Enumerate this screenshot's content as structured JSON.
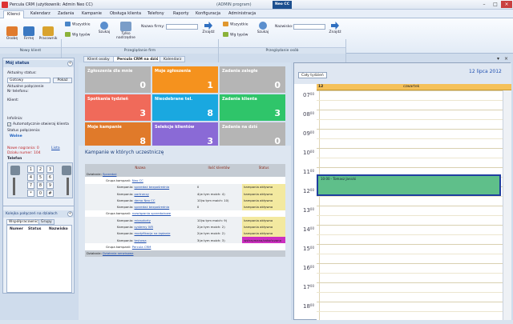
{
  "window": {
    "title": "Percula CRM (użytkownik: Admin Neo CC)",
    "center_title": "(ADMIN program)",
    "brand": "Neo CC"
  },
  "menu": {
    "tabs": [
      "Klienci",
      "Kalendarz",
      "Zadania",
      "Kampanie",
      "Obsługa klienta",
      "Telefony",
      "Raporty",
      "Konfiguracja",
      "Administracja"
    ],
    "active": "Klienci"
  },
  "ribbon": {
    "nowy_klient": {
      "label": "Nowy klient",
      "buttons": [
        "Osobę",
        "Firmę",
        "Pracownik"
      ]
    },
    "przegladanie_firm": {
      "label": "Przeglądanie firm",
      "wszystkie": "Wszystkie",
      "wg_typow": "Wg typów",
      "szukaj": "Szukaj",
      "tylko_nadrzedne": "Tylko nadrzędne",
      "nazwa_firmy": "Nazwa firmy:",
      "znajdz": "Znajdź"
    },
    "przegladanie_osob": {
      "label": "Przeglądanie osób",
      "wszystkie": "Wszystkie",
      "wg_typow": "Wg typów",
      "szukaj": "Szukaj",
      "nazwisko": "Nazwisko:",
      "znajdz": "Znajdź"
    }
  },
  "subtabs": [
    "Klient osoby",
    "Percula CRM na dziś",
    "Kalendarz"
  ],
  "left": {
    "title": "Mój status",
    "aktualny_status": "Aktualny status:",
    "status_value": "Gotowy",
    "pokaz": "Pokaż",
    "aktualne_polaczenie": "Aktualne połączenie",
    "nr_telefonu": "Nr telefonu:",
    "klient": "Klient:",
    "infolinia": "Infolinia:",
    "auto_klient": "Automatycznie otwieraj klienta",
    "status_polaczenia": "Status połączenia:",
    "status_polaczenia_val": "Wolne",
    "nowe_nagrania": "Nowe nagrania:  0",
    "lista": "Lista",
    "dzialy_numer": "Działu numer: 104",
    "telefon": "Telefon",
    "keypad": [
      "1",
      "2",
      "3",
      "4",
      "5",
      "6",
      "7",
      "8",
      "9",
      "*",
      "0",
      "#"
    ],
    "kolejka_title": "Kolejka połączeń na działach",
    "kolejka_tabs": [
      "Współpracownicy",
      "Grupy"
    ],
    "kolejka_cols": [
      "Numer",
      "Status",
      "Nazwisko"
    ]
  },
  "tiles": [
    {
      "label": "Zgłoszenia dla mnie",
      "value": "0",
      "color": "#b5b5b5"
    },
    {
      "label": "Moje zgłoszenia",
      "value": "1",
      "color": "#f5921e"
    },
    {
      "label": "Zadania zaległe",
      "value": "0",
      "color": "#b5b5b5"
    },
    {
      "label": "Spotkania tydzień",
      "value": "3",
      "color": "#f06a5a"
    },
    {
      "label": "Nieodebrane tel.",
      "value": "8",
      "color": "#1aa8e0"
    },
    {
      "label": "Zadania klienta",
      "value": "3",
      "color": "#2fc56a"
    },
    {
      "label": "Moje kampanie",
      "value": "8",
      "color": "#e07a2a"
    },
    {
      "label": "Selekcje klientów",
      "value": "3",
      "color": "#8a6ad6"
    },
    {
      "label": "Zadania na dziś",
      "value": "0",
      "color": "#b5b5b5"
    }
  ],
  "campaigns": {
    "title": "Kampanie w których uczestniczę",
    "headers": [
      "Nazwa",
      "Ilość klientów",
      "Status"
    ],
    "rows": [
      {
        "kind": "dzial",
        "prefix": "Działanie:",
        "name": "Sprzedaż"
      },
      {
        "kind": "grupa",
        "prefix": "Grupa kampanii:",
        "name": "Neo CC"
      },
      {
        "kind": "kamp",
        "prefix": "Kampania:",
        "name": "sprzedaż bezpośrednia",
        "count": "0",
        "status": "kampania aktywna",
        "scolor": "#f3e9a0"
      },
      {
        "kind": "kamp",
        "prefix": "Kampania:",
        "name": "partnerzy",
        "count": "4(w tym moich: 4)",
        "status": "kampania aktywna",
        "scolor": "#f3e9a0"
      },
      {
        "kind": "kamp",
        "prefix": "Kampania:",
        "name": "demo Neo CC",
        "count": "10(w tym moich: 10)",
        "status": "kampania aktywna",
        "scolor": "#f3e9a0"
      },
      {
        "kind": "kamp",
        "prefix": "Kampania:",
        "name": "sprzedaż bezpośrednia",
        "count": "0",
        "status": "kampania aktywna",
        "scolor": "#f3e9a0"
      },
      {
        "kind": "grupa",
        "prefix": "Grupa kampanii:",
        "name": "rozwiązania sprzedażowe"
      },
      {
        "kind": "kamp",
        "prefix": "Kampania:",
        "name": "mięsotorty",
        "count": "10(w tym moich: 9)",
        "status": "kampania aktywna",
        "scolor": "#f3e9a0"
      },
      {
        "kind": "kamp",
        "prefix": "Kampania:",
        "name": "systemy IVR",
        "count": "2(w tym moich: 2)",
        "status": "kampania aktywna",
        "scolor": "#f3e9a0"
      },
      {
        "kind": "kamp",
        "prefix": "Kampania:",
        "name": "modyfikacja na żądanie",
        "count": "2(w tym moich: 2)",
        "status": "kampania aktywna",
        "scolor": "#f3e9a0"
      },
      {
        "kind": "kamp",
        "prefix": "Kampania:",
        "name": "testowa",
        "count": "3(w tym moich: 3)",
        "status": "wstrzymana/zakończona",
        "scolor": "#cc2fc0"
      },
      {
        "kind": "grupa",
        "prefix": "Grupa kampanii:",
        "name": "Percula CRM"
      },
      {
        "kind": "dzial",
        "prefix": "Działanie:",
        "name": "Działania serwisowe"
      }
    ]
  },
  "calendar": {
    "btn": "Cały tydzień",
    "date": "12 lipca 2012",
    "day_num": "12",
    "day_name": "czwartek",
    "hours": [
      "07",
      "08",
      "09",
      "10",
      "11",
      "12",
      "13",
      "14",
      "15",
      "16",
      "17",
      "18"
    ],
    "event": "10:00 · Tomasz Janicki"
  }
}
